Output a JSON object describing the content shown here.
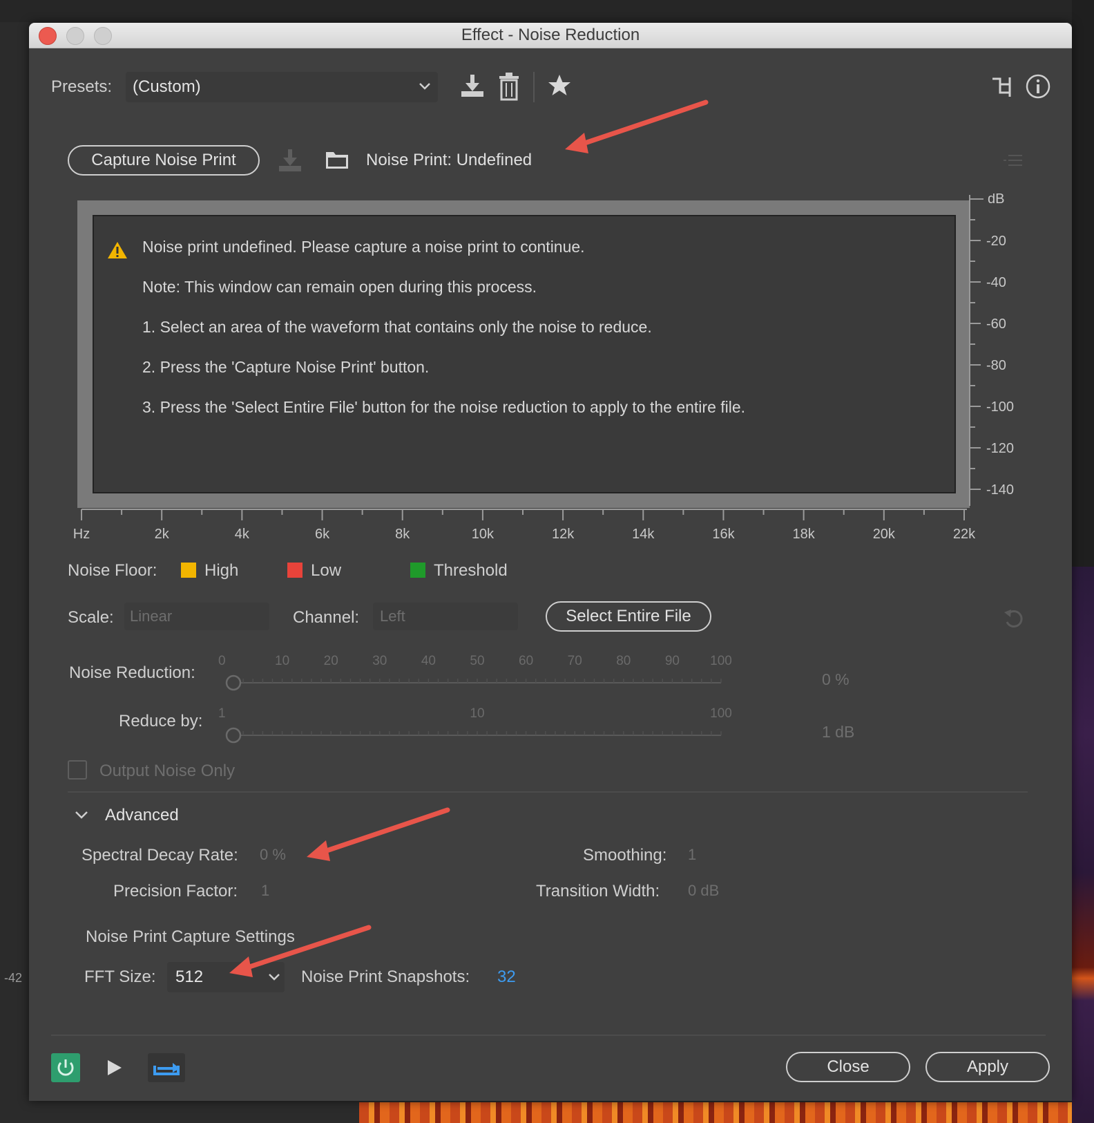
{
  "window": {
    "title": "Effect - Noise Reduction"
  },
  "presets": {
    "label": "Presets:",
    "value": "(Custom)"
  },
  "noise_print": {
    "capture_button": "Capture Noise Print",
    "status_label": "Noise Print:",
    "status_value": "Undefined"
  },
  "graph": {
    "messages": [
      "Noise print undefined. Please capture a noise print to continue.",
      "Note: This window can remain open during this process.",
      "1. Select an area of the waveform that contains only the noise to reduce.",
      "2. Press the 'Capture Noise Print' button.",
      "3. Press the 'Select Entire File' button for the noise reduction to apply to the entire file."
    ],
    "x_ticks": [
      "Hz",
      "2k",
      "4k",
      "6k",
      "8k",
      "10k",
      "12k",
      "14k",
      "16k",
      "18k",
      "20k",
      "22k"
    ],
    "y_unit": "dB",
    "y_ticks": [
      "-20",
      "-40",
      "-60",
      "-80",
      "-100",
      "-120",
      "-140"
    ]
  },
  "legend": {
    "label": "Noise Floor:",
    "items": [
      {
        "label": "High",
        "color": "#f2b500"
      },
      {
        "label": "Low",
        "color": "#e8433a"
      },
      {
        "label": "Threshold",
        "color": "#1f9a2a"
      }
    ]
  },
  "scale": {
    "label": "Scale:",
    "value": "Linear"
  },
  "channel": {
    "label": "Channel:",
    "value": "Left"
  },
  "select_entire_file": "Select Entire File",
  "noise_reduction": {
    "label": "Noise Reduction:",
    "ticks": [
      "0",
      "10",
      "20",
      "30",
      "40",
      "50",
      "60",
      "70",
      "80",
      "90",
      "100"
    ],
    "value_text": "0 %",
    "value": 0
  },
  "reduce_by": {
    "label": "Reduce by:",
    "ticks": [
      "1",
      "10",
      "100"
    ],
    "value_text": "1 dB",
    "value": 1
  },
  "output_noise_only": {
    "label": "Output Noise Only",
    "checked": false
  },
  "advanced": {
    "label": "Advanced",
    "spectral_decay_label": "Spectral Decay Rate:",
    "spectral_decay_value": "0 %",
    "smoothing_label": "Smoothing:",
    "smoothing_value": "1",
    "precision_label": "Precision Factor:",
    "precision_value": "1",
    "transition_label": "Transition Width:",
    "transition_value": "0 dB",
    "capture_settings_label": "Noise Print Capture Settings",
    "fft_label": "FFT Size:",
    "fft_value": "512",
    "snapshots_label": "Noise Print Snapshots:",
    "snapshots_value": "32"
  },
  "footer": {
    "close": "Close",
    "apply": "Apply"
  },
  "background": {
    "left_value": "-42"
  },
  "colors": {
    "accent_link": "#3d9bf0",
    "annotation_arrow": "#e8554a",
    "power_green": "#2e9e6e"
  }
}
